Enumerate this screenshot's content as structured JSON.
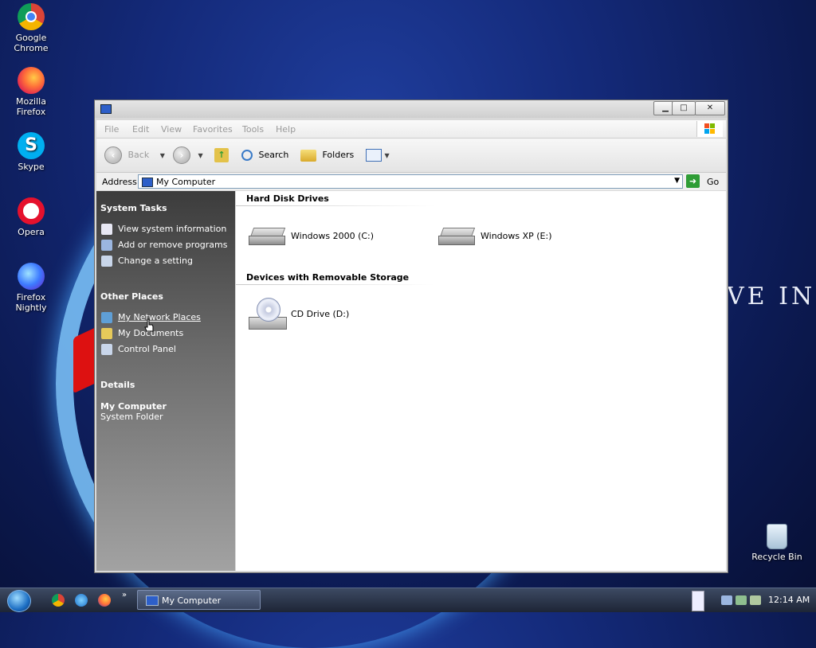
{
  "desktop": {
    "icons": [
      {
        "label": "Google Chrome",
        "icon": "chrome-icon"
      },
      {
        "label": "Mozilla Firefox",
        "icon": "firefox-icon"
      },
      {
        "label": "Skype",
        "icon": "skype-icon"
      },
      {
        "label": "Opera",
        "icon": "opera-icon"
      },
      {
        "label": "Firefox Nightly",
        "icon": "firefox-nightly-icon"
      },
      {
        "label": "Recycle Bin",
        "icon": "recycle-bin-icon"
      }
    ],
    "slogan": "VE IN"
  },
  "window": {
    "title": "",
    "controls": {
      "minimize": "▁",
      "maximize": "□",
      "close": "✕"
    },
    "menu": [
      "File",
      "Edit",
      "View",
      "Favorites",
      "Tools",
      "Help"
    ],
    "toolbar": {
      "back": "Back",
      "search": "Search",
      "folders": "Folders"
    },
    "address": {
      "label": "Address",
      "value": "My Computer",
      "go": "Go"
    },
    "left_pane": {
      "system_tasks": {
        "heading": "System Tasks",
        "items": [
          "View system information",
          "Add or remove programs",
          "Change a setting"
        ]
      },
      "other_places": {
        "heading": "Other Places",
        "items": [
          "My Network Places",
          "My Documents",
          "Control Panel"
        ]
      },
      "details": {
        "heading": "Details",
        "name": "My Computer",
        "type": "System Folder"
      }
    },
    "content": {
      "hard_disk": {
        "heading": "Hard Disk Drives",
        "drives": [
          "Windows 2000 (C:)",
          "Windows XP (E:)"
        ]
      },
      "removable": {
        "heading": "Devices with Removable Storage",
        "drives": [
          "CD Drive (D:)"
        ]
      }
    }
  },
  "taskbar": {
    "task_button": "My Computer",
    "more": "»",
    "clock": "12:14 AM"
  },
  "colors": {
    "go_green": "#2f9d36",
    "accent_blue": "#2d5fc9"
  }
}
